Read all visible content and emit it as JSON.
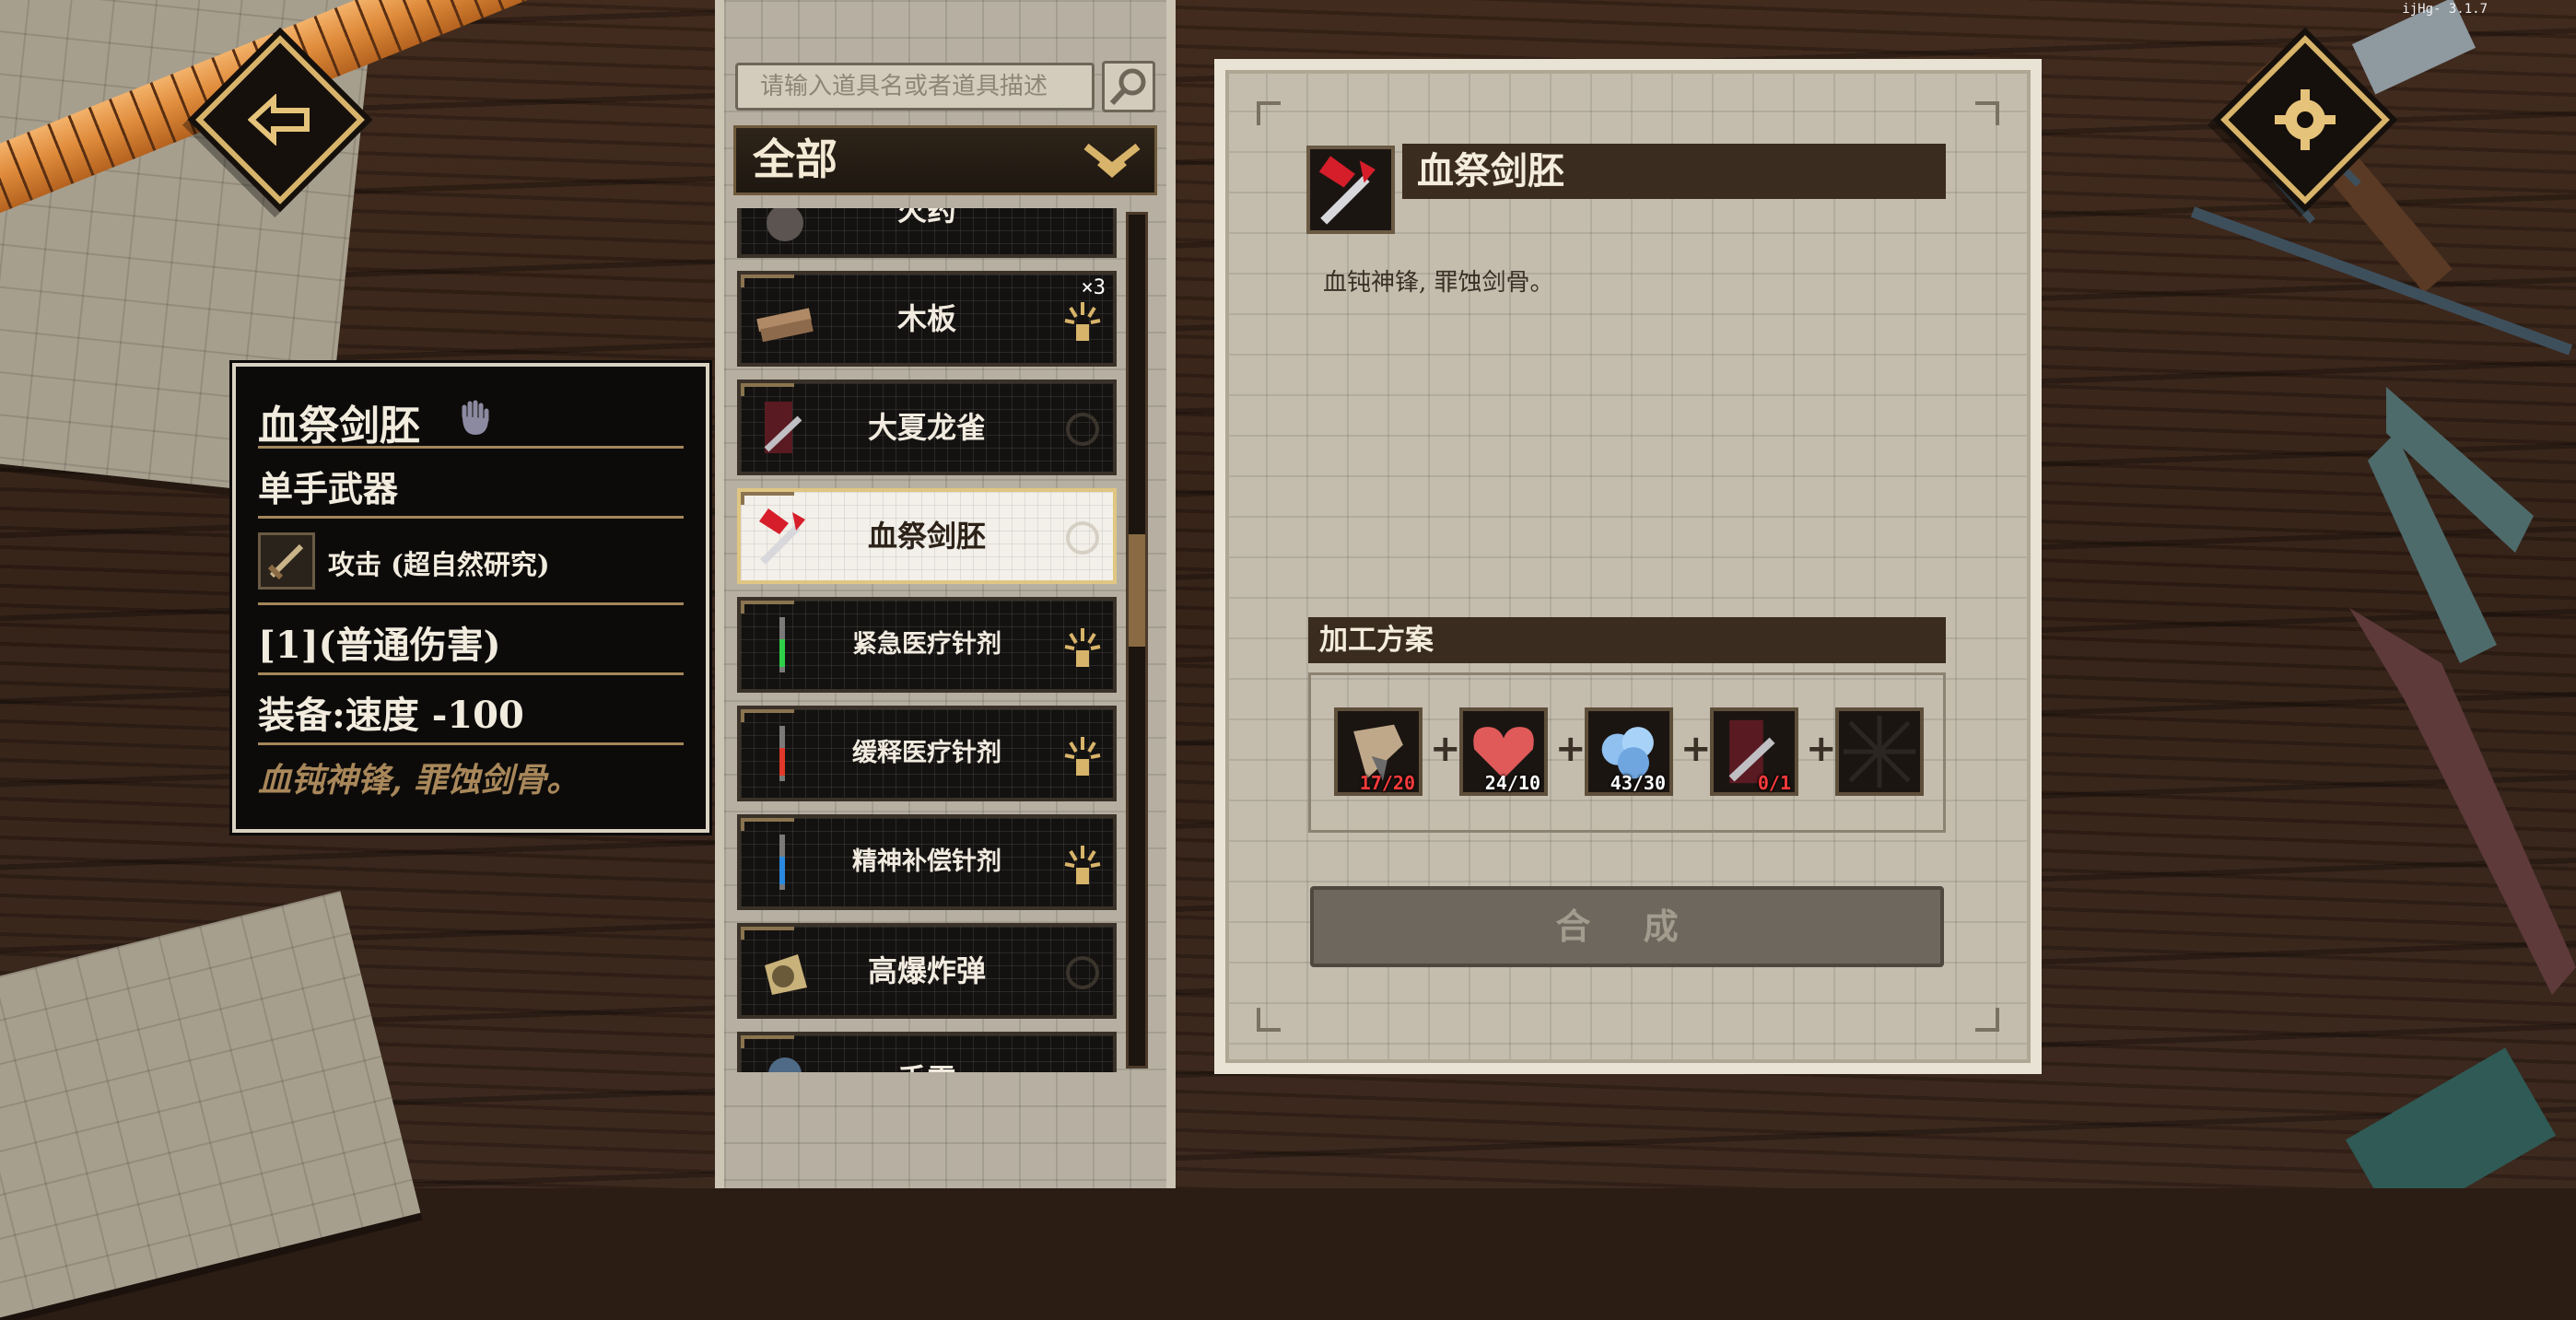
{
  "version": "ijHg-  3.1.7",
  "nav": {
    "back_icon": "back-arrow-icon",
    "settings_icon": "gear-icon"
  },
  "search": {
    "placeholder": "请输入道具名或者道具描述",
    "icon": "magnifier-icon"
  },
  "category": {
    "selected": "全部",
    "icon": "chevron-down-icon"
  },
  "items": [
    {
      "name": "火药",
      "icon": "gunpowder-icon",
      "count": ""
    },
    {
      "name": "木板",
      "icon": "wood-plank-icon",
      "count": "×3"
    },
    {
      "name": "大夏龙雀",
      "icon": "blade-icon",
      "count": ""
    },
    {
      "name": "血祭剑胚",
      "icon": "blood-sword-icon",
      "count": "",
      "selected": true
    },
    {
      "name": "紧急医疗针剂",
      "icon": "green-syringe-icon",
      "count": ""
    },
    {
      "name": "缓释医疗针剂",
      "icon": "red-syringe-icon",
      "count": ""
    },
    {
      "name": "精神补偿针剂",
      "icon": "blue-syringe-icon",
      "count": ""
    },
    {
      "name": "高爆炸弹",
      "icon": "bomb-icon",
      "count": ""
    },
    {
      "name": "手雷",
      "icon": "grenade-icon",
      "count": ""
    }
  ],
  "tooltip": {
    "name": "血祭剑胚",
    "type": "单手武器",
    "skill": "攻击 (超自然研究)",
    "damage": "[1](普通伤害)",
    "equip": "装备:速度 -100",
    "flavor": "血钝神锋, 罪蚀剑骨。"
  },
  "detail": {
    "title": "血祭剑胚",
    "description": "血钝神锋, 罪蚀剑骨。",
    "plan_label": "加工方案",
    "materials": [
      {
        "icon": "scrap-icon",
        "qty": "17/20",
        "enough": false
      },
      {
        "icon": "heart-meat-icon",
        "qty": "24/10",
        "enough": true
      },
      {
        "icon": "blue-crystal-icon",
        "qty": "43/30",
        "enough": true
      },
      {
        "icon": "blade-icon",
        "qty": "0/1",
        "enough": false
      },
      {
        "icon": "empty-slot-icon",
        "qty": "",
        "enough": true
      }
    ],
    "plus": "+",
    "craft_label": "合 成"
  },
  "colors": {
    "accent": "#d8b46a",
    "short": "#ff3b3b",
    "panel": "#c4bdae"
  }
}
